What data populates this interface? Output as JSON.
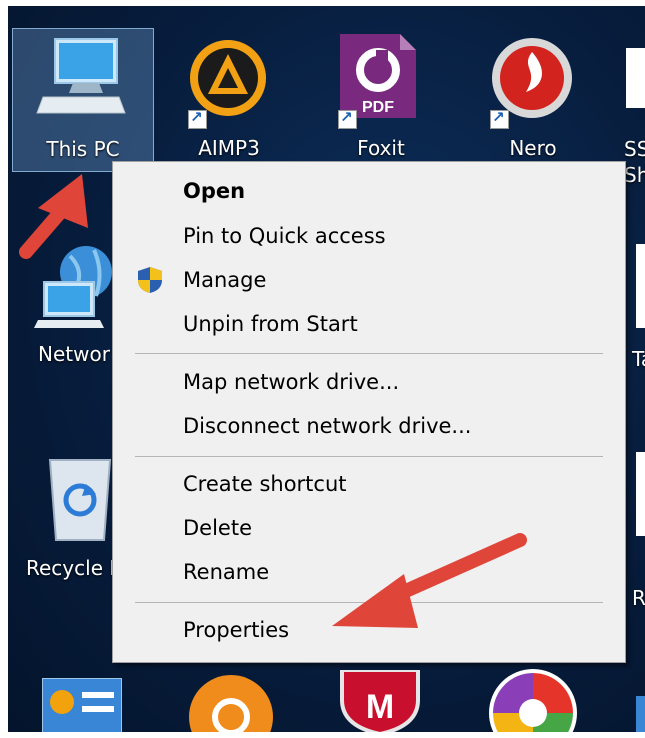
{
  "desktop": {
    "icons_row1": [
      {
        "label": "This PC",
        "icon": "computer-icon"
      },
      {
        "label": "AIMP3",
        "icon": "aimp-icon"
      },
      {
        "label": "Foxit",
        "icon": "foxit-pdf-icon",
        "badge": "PDF"
      },
      {
        "label": "Nero",
        "icon": "nero-icon"
      },
      {
        "label": "SS\nSh",
        "icon": "partial-icon"
      }
    ],
    "icons_left": [
      {
        "label": "Networ",
        "icon": "network-icon"
      },
      {
        "label": "Recycle I",
        "icon": "recycle-bin-icon"
      }
    ],
    "icons_right": [
      {
        "label": "Ta"
      },
      {
        "label": "Re"
      }
    ],
    "bottom_icons": [
      "control-panel-icon",
      "helm-icon",
      "mcafee-icon",
      "picasa-icon"
    ],
    "mcafee_letter": "M"
  },
  "context_menu": {
    "items": [
      {
        "label": "Open",
        "bold": true
      },
      {
        "label": "Pin to Quick access"
      },
      {
        "label": "Manage",
        "icon": "uac-shield-icon"
      },
      {
        "label": "Unpin from Start"
      },
      {
        "label": "Map network drive..."
      },
      {
        "label": "Disconnect network drive..."
      },
      {
        "label": "Create shortcut"
      },
      {
        "label": "Delete"
      },
      {
        "label": "Rename"
      },
      {
        "label": "Properties"
      }
    ]
  },
  "colors": {
    "desktop_bg": "#071d3d",
    "menu_bg": "#f0f0f0",
    "arrow": "#e0453a"
  }
}
